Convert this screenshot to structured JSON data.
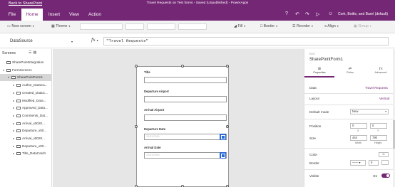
{
  "titlebar": {
    "back_link": "Back to SharePoint",
    "title": "Travel Requests on Test forms - Saved (Unpublished) - PowerApps"
  },
  "menubar": {
    "tabs": [
      "File",
      "Home",
      "Insert",
      "View",
      "Action"
    ],
    "active_tab": "Home",
    "org": "Cork, Bottle, and Barel (default)",
    "icons": [
      "help-icon",
      "undo-icon",
      "redo-icon",
      "run-icon",
      "person-icon"
    ]
  },
  "ribbon": {
    "new_screen": "New screen",
    "theme": "Theme",
    "fill": "Fill",
    "border": "Border",
    "reorder": "Reorder",
    "align": "Align",
    "group": "Group"
  },
  "formula_bar": {
    "property": "DataSource",
    "fx": "fx",
    "formula": "\"Travel Requests\""
  },
  "left_panel": {
    "heading": "Screens",
    "tree": [
      {
        "label": "SharePointIntegration",
        "level": 0,
        "expand": ""
      },
      {
        "label": "FormScreen1",
        "level": 0,
        "expand": "▾"
      },
      {
        "label": "SharePointForm1",
        "level": 1,
        "expand": "▾",
        "selected": true
      },
      {
        "label": "Author_DataCa...",
        "level": 2,
        "expand": "▸"
      },
      {
        "label": "Created_DataC...",
        "level": 2,
        "expand": "▸"
      },
      {
        "label": "Modified_Data...",
        "level": 2,
        "expand": "▸"
      },
      {
        "label": "Approved_Data...",
        "level": 2,
        "expand": "▸"
      },
      {
        "label": "Comments_Dat...",
        "level": 2,
        "expand": "▸"
      },
      {
        "label": "Arrival_x0020...",
        "level": 2,
        "expand": "▸"
      },
      {
        "label": "Departure_x00...",
        "level": 2,
        "expand": "▸"
      },
      {
        "label": "Arrival_x0020...",
        "level": 2,
        "expand": "▸"
      },
      {
        "label": "Departure_x00...",
        "level": 2,
        "expand": "▸"
      },
      {
        "label": "Title_DataCard1",
        "level": 2,
        "expand": "▸"
      }
    ]
  },
  "form": {
    "fields": [
      {
        "label": "Title",
        "placeholder": "",
        "date": false
      },
      {
        "label": "Departure Airport",
        "placeholder": "",
        "date": false
      },
      {
        "label": "Arrival Airport",
        "placeholder": "",
        "date": false
      },
      {
        "label": "Departure Date",
        "placeholder": "12/31/2001",
        "date": true
      },
      {
        "label": "Arrival Date",
        "placeholder": "12/31/2001",
        "date": true
      }
    ]
  },
  "right_panel": {
    "type_label": "EDIT",
    "name": "SharePointForm1",
    "tabs": [
      "Properties",
      "Rules",
      "Advanced"
    ],
    "active_tab": "Properties",
    "data_label": "Data",
    "data_value": "Travel Requests",
    "layout_label": "Layout",
    "layout_value": "Vertical",
    "default_mode_label": "Default mode",
    "default_mode_value": "New",
    "position_label": "Position",
    "position_x": "0",
    "position_y": "0",
    "x_label": "X",
    "y_label": "Y",
    "size_label": "Size",
    "width": "444",
    "height": "790",
    "width_label": "Width",
    "height_label": "Height",
    "color_label": "Color",
    "color_btn": "fx",
    "border_label": "Border",
    "border_width": "0",
    "visible_label": "Visible",
    "visible_value": "On"
  }
}
